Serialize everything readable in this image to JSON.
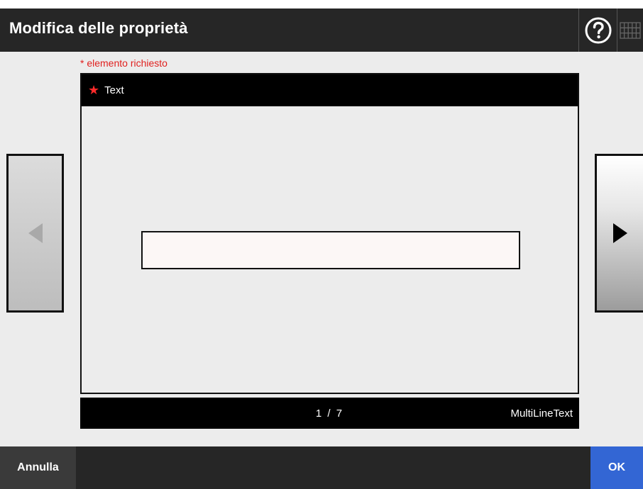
{
  "header": {
    "title": "Modifica delle proprietà",
    "help_icon": "question-circle-icon",
    "keyboard_icon": "keyboard-icon"
  },
  "form": {
    "required_note": "* elemento richiesto",
    "field_label": "Text",
    "required_marker": "★",
    "input_value": "",
    "input_placeholder": ""
  },
  "navigation": {
    "prev_icon": "triangle-left-icon",
    "next_icon": "triangle-right-icon"
  },
  "status": {
    "page_counter": "1 / 7",
    "field_type": "MultiLineText"
  },
  "footer": {
    "cancel_label": "Annulla",
    "ok_label": "OK"
  },
  "colors": {
    "required_red": "#e0201e",
    "ok_blue": "#3366d4",
    "bar_dark": "#262626"
  }
}
